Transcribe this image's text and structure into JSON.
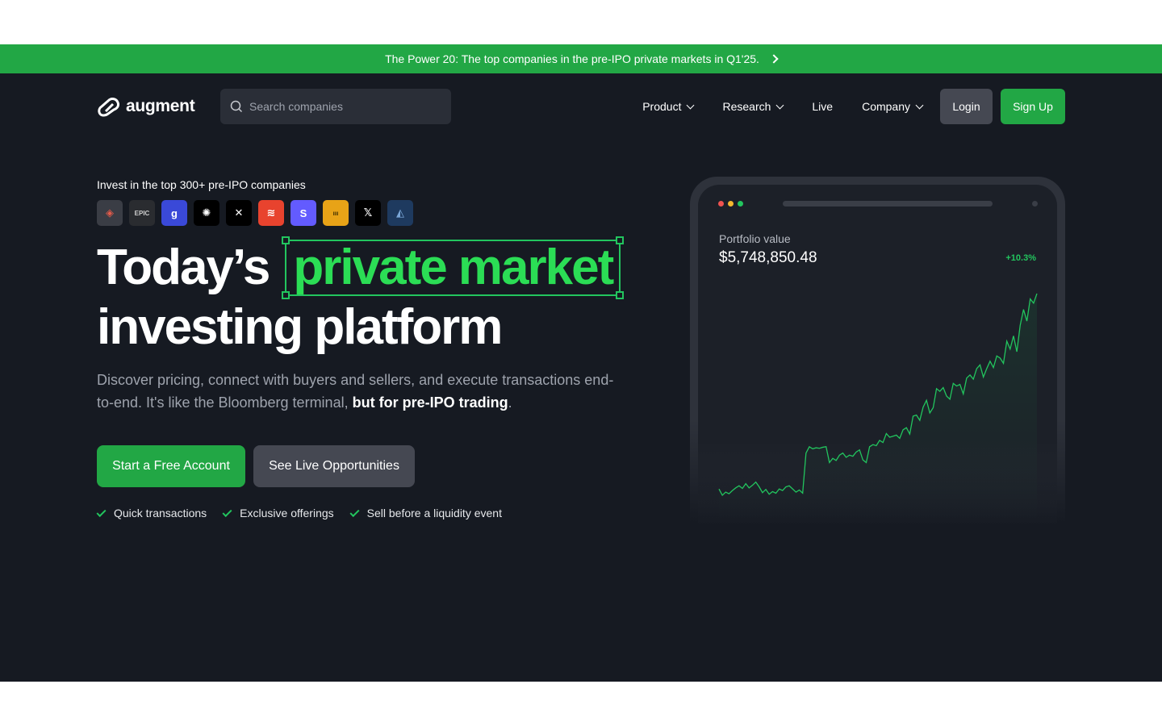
{
  "promo": {
    "text": "The Power 20: The top companies in the pre-IPO private markets in Q1'25."
  },
  "nav": {
    "brand": "augment",
    "search_placeholder": "Search companies",
    "items": [
      {
        "label": "Product",
        "dropdown": true
      },
      {
        "label": "Research",
        "dropdown": true
      },
      {
        "label": "Live",
        "dropdown": false
      },
      {
        "label": "Company",
        "dropdown": true
      }
    ],
    "login": "Login",
    "signup": "Sign Up"
  },
  "hero": {
    "eyebrow": "Invest in the top 300+ pre-IPO companies",
    "companies": [
      {
        "name": "databricks-logo",
        "glyph": "◈",
        "bg": "#3a3d45",
        "fg": "#e25b4a"
      },
      {
        "name": "epic-games-logo",
        "glyph": "EPIC",
        "bg": "#2a2c30",
        "fg": "#cfcfcf"
      },
      {
        "name": "glean-logo",
        "glyph": "g",
        "bg": "#3a49d8",
        "fg": "#ffffff"
      },
      {
        "name": "openai-logo",
        "glyph": "✺",
        "bg": "#000000",
        "fg": "#ffffff"
      },
      {
        "name": "spacex-logo",
        "glyph": "✕",
        "bg": "#000000",
        "fg": "#ffffff"
      },
      {
        "name": "layers-logo",
        "glyph": "≋",
        "bg": "#e8432e",
        "fg": "#ffffff"
      },
      {
        "name": "stripe-logo",
        "glyph": "S",
        "bg": "#635bff",
        "fg": "#ffffff"
      },
      {
        "name": "brex-logo",
        "glyph": "ııı",
        "bg": "#e8a317",
        "fg": "#3a2a00"
      },
      {
        "name": "x-logo",
        "glyph": "𝕏",
        "bg": "#000000",
        "fg": "#ffffff"
      },
      {
        "name": "anduril-logo",
        "glyph": "◭",
        "bg": "#1e3a5f",
        "fg": "#7aa7d8"
      }
    ],
    "headline_prefix": "Today’s",
    "headline_highlight": "private market",
    "headline_line2": "investing platform",
    "subtext_plain": "Discover pricing, connect with buyers and sellers, and execute transactions end-to-end. It's like the Bloomberg terminal, ",
    "subtext_bold": "but for pre-IPO trading",
    "subtext_end": ".",
    "cta_primary": "Start a Free Account",
    "cta_secondary": "See Live Opportunities",
    "features": [
      "Quick transactions",
      "Exclusive offerings",
      "Sell before a liquidity event"
    ]
  },
  "portfolio": {
    "label": "Portfolio value",
    "value": "$5,748,850.48",
    "change": "+10.3%",
    "line_color": "#22c55e",
    "traffic_colors": [
      "#ef5350",
      "#f5b82e",
      "#22c55e"
    ]
  },
  "chart_data": {
    "type": "line",
    "series": [
      {
        "values": [
          20,
          8,
          14,
          11,
          17,
          22,
          26,
          21,
          30,
          22,
          27,
          33,
          24,
          13,
          19,
          10,
          15,
          12,
          20,
          17,
          24,
          26,
          20,
          14,
          18,
          12,
          88,
          100,
          96,
          98,
          97,
          99,
          100,
          70,
          78,
          74,
          84,
          88,
          80,
          84,
          82,
          90,
          94,
          75,
          70,
          100,
          104,
          102,
          112,
          108,
          125,
          118,
          120,
          122,
          116,
          132,
          136,
          124,
          158,
          160,
          150,
          175,
          188,
          164,
          174,
          210,
          205,
          212,
          196,
          190,
          220,
          215,
          218,
          200,
          230,
          236,
          228,
          248,
          255,
          232,
          248,
          262,
          250,
          272,
          268,
          258,
          300,
          285,
          310,
          280,
          330,
          360,
          338,
          380,
          372,
          390
        ]
      }
    ]
  }
}
